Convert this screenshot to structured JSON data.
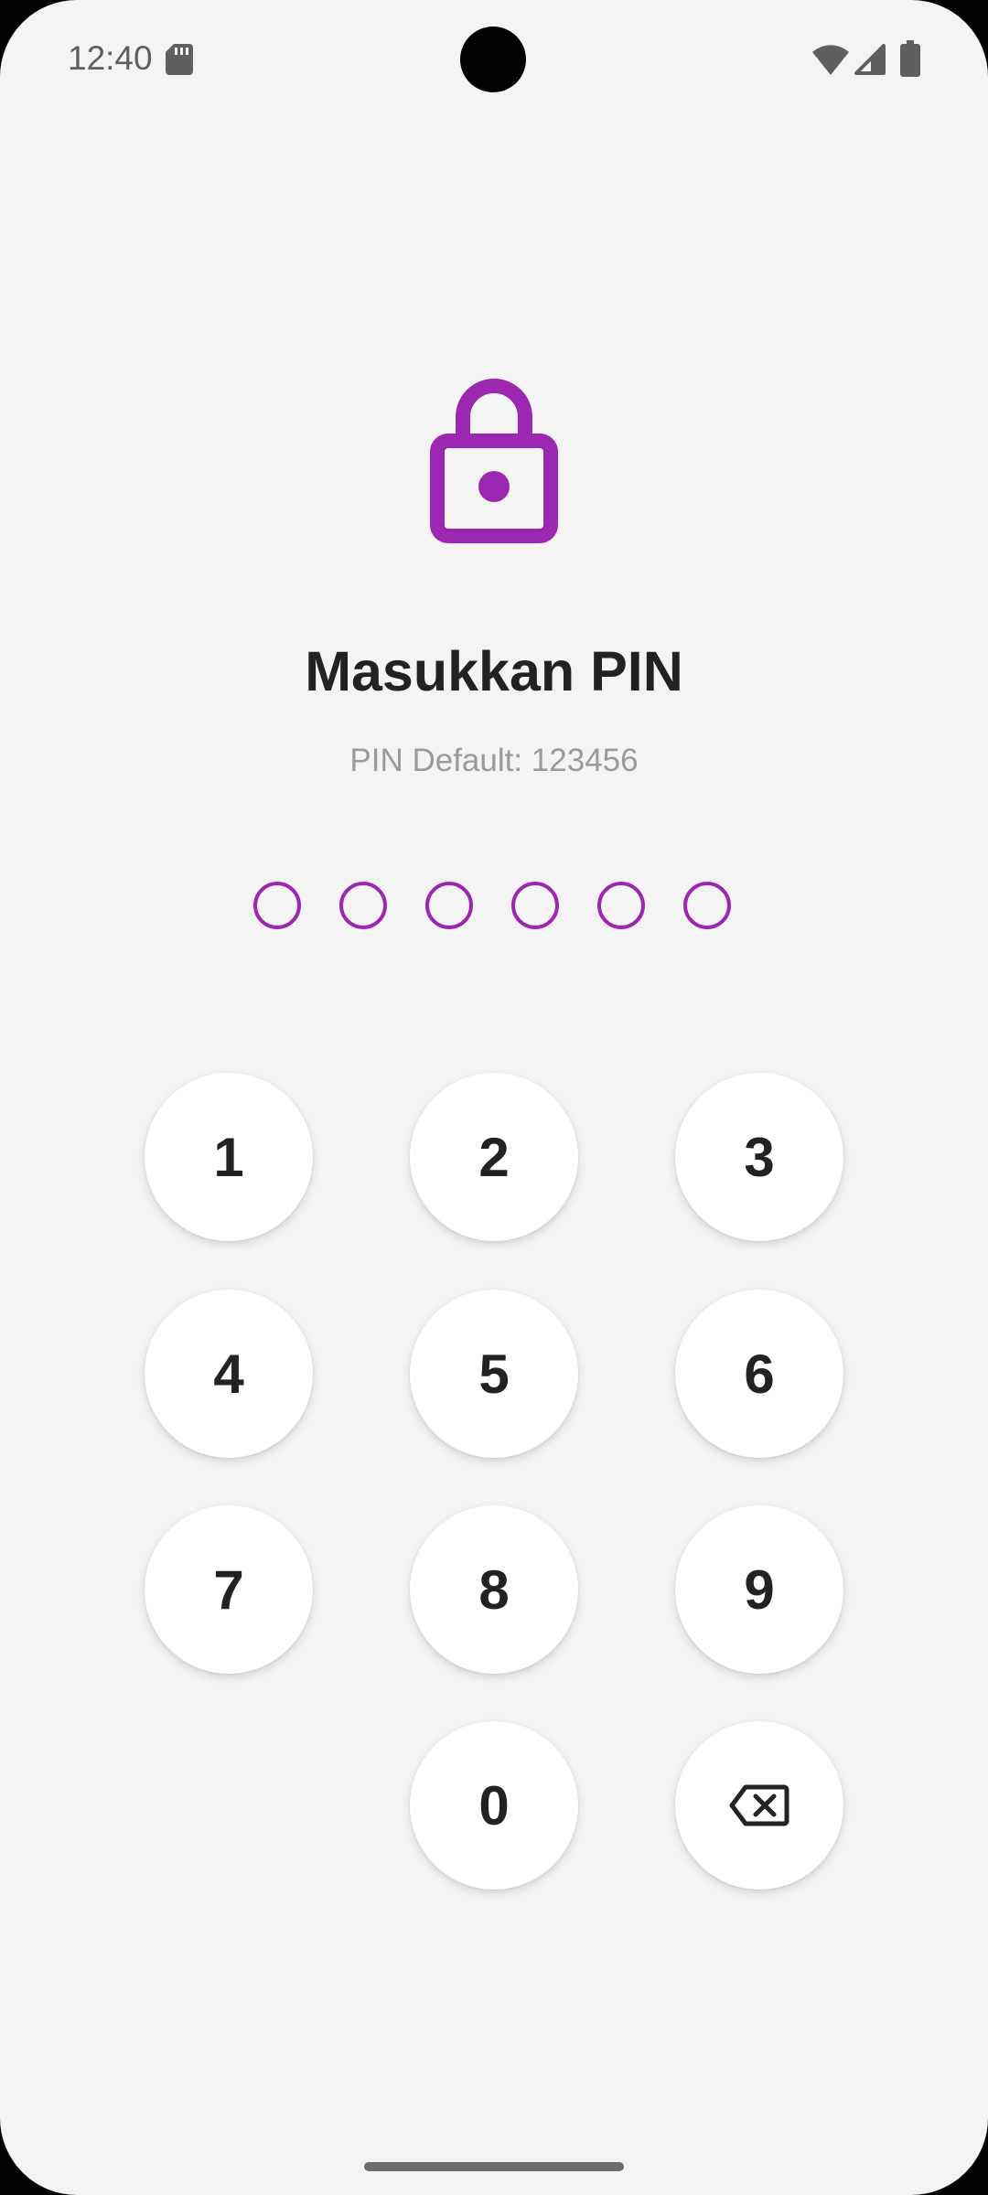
{
  "status_bar": {
    "time": "12:40",
    "icons": [
      "sd-card-icon",
      "wifi-icon",
      "signal-icon",
      "battery-icon"
    ]
  },
  "header": {
    "icon": "lock-icon",
    "title": "Masukkan PIN",
    "subtitle": "PIN Default: 123456"
  },
  "pin": {
    "length": 6,
    "filled": 0
  },
  "keypad": {
    "keys": [
      "1",
      "2",
      "3",
      "4",
      "5",
      "6",
      "7",
      "8",
      "9",
      "0"
    ],
    "backspace_icon": "backspace-icon"
  },
  "colors": {
    "accent": "#9c27b0",
    "background": "#f4f4f4",
    "key_background": "#ffffff",
    "text_primary": "#222222",
    "text_secondary": "#9a9a9a"
  }
}
